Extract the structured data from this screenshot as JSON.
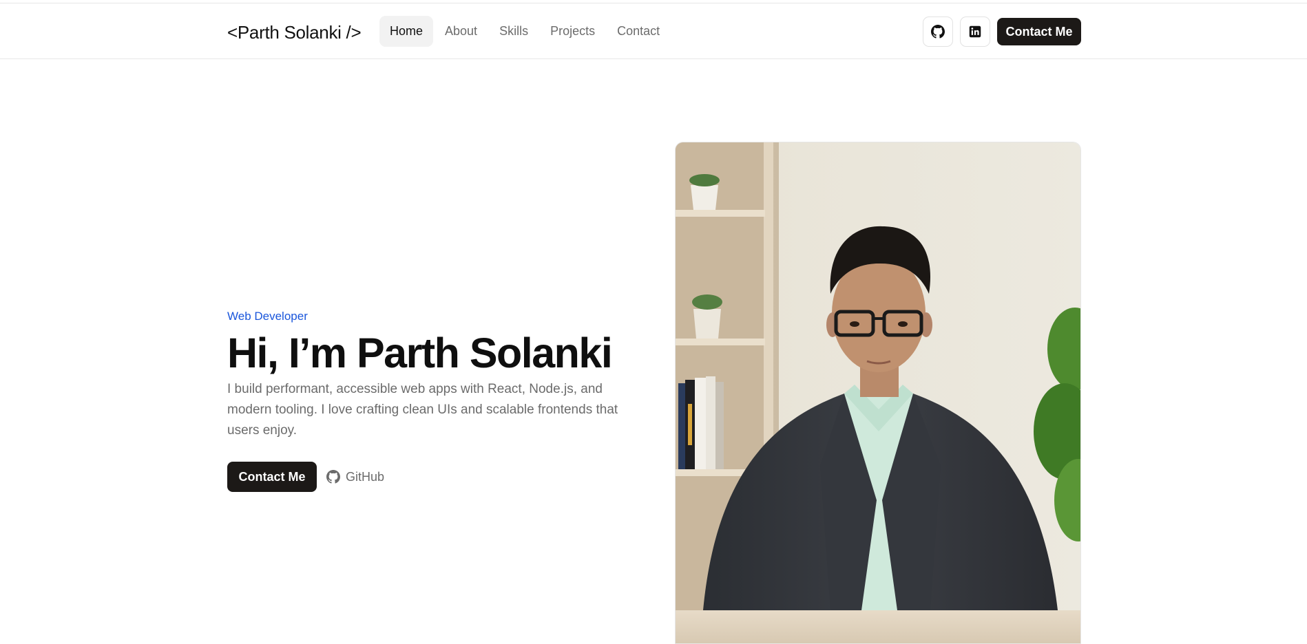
{
  "nav": {
    "brand": "<Parth Solanki />",
    "links": [
      {
        "label": "Home",
        "active": true
      },
      {
        "label": "About"
      },
      {
        "label": "Skills"
      },
      {
        "label": "Projects"
      },
      {
        "label": "Contact"
      }
    ],
    "icons": [
      "github-icon",
      "linkedin-icon"
    ],
    "cta_label": "Contact Me"
  },
  "hero": {
    "eyebrow": "Web Developer",
    "headline": "Hi, I’m Parth Solanki",
    "lead": "I build performant, accessible web apps with React, Node.js, and modern tooling. I love crafting clean UIs and scalable frontends that users enjoy.",
    "cta_label": "Contact Me",
    "github_label": "GitHub",
    "photo_alt": "Parth Solanki"
  },
  "colors": {
    "accent": "#1a56db",
    "button_dark": "#1c1917",
    "muted_text": "#6b6b6b"
  }
}
